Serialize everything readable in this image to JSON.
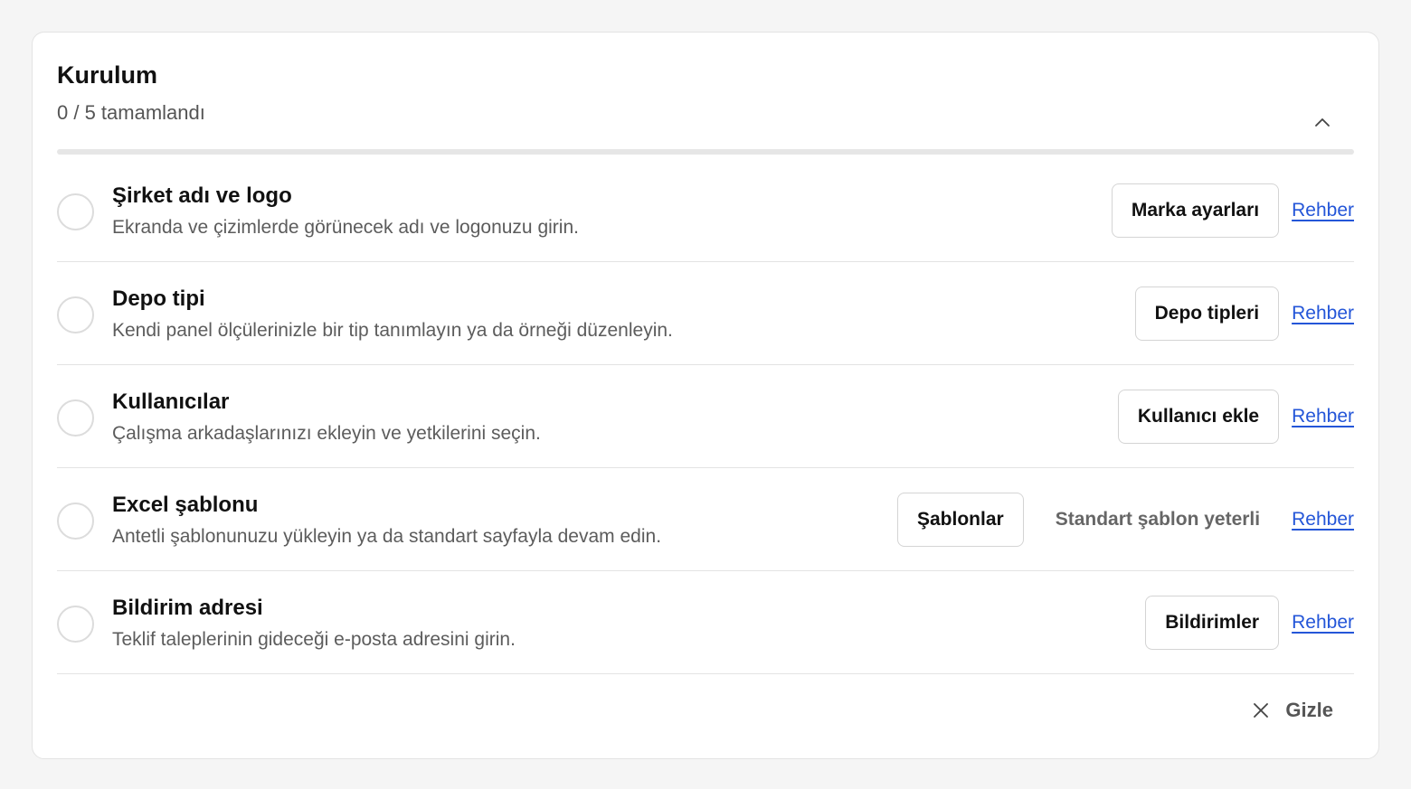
{
  "header": {
    "title": "Kurulum",
    "progress_text": "0 / 5 tamamlandı",
    "completed": 0,
    "total": 5
  },
  "steps": [
    {
      "title": "Şirket adı ve logo",
      "description": "Ekranda ve çizimlerde görünecek adı ve logonuzu girin.",
      "button_label": "Marka ayarları",
      "note": "",
      "link_label": "Rehber",
      "completed": false
    },
    {
      "title": "Depo tipi",
      "description": "Kendi panel ölçülerinizle bir tip tanımlayın ya da örneği düzenleyin.",
      "button_label": "Depo tipleri",
      "note": "",
      "link_label": "Rehber",
      "completed": false
    },
    {
      "title": "Kullanıcılar",
      "description": "Çalışma arkadaşlarınızı ekleyin ve yetkilerini seçin.",
      "button_label": "Kullanıcı ekle",
      "note": "",
      "link_label": "Rehber",
      "completed": false
    },
    {
      "title": "Excel şablonu",
      "description": "Antetli şablonunuzu yükleyin ya da standart sayfayla devam edin.",
      "button_label": "Şablonlar",
      "note": "Standart şablon yeterli",
      "link_label": "Rehber",
      "completed": false
    },
    {
      "title": "Bildirim adresi",
      "description": "Teklif taleplerinin gideceği e-posta adresini girin.",
      "button_label": "Bildirimler",
      "note": "",
      "link_label": "Rehber",
      "completed": false
    }
  ],
  "footer": {
    "hide_label": "Gizle"
  },
  "icons": {
    "collapse": "chevron-up-icon",
    "hide": "close-icon"
  },
  "colors": {
    "link": "#2456d8",
    "progress_track": "#e6e6e6"
  }
}
